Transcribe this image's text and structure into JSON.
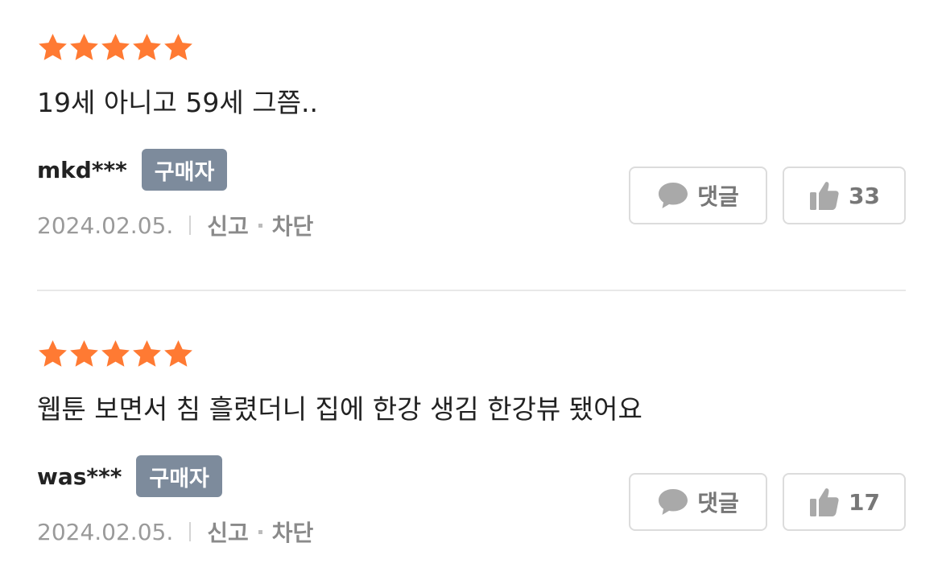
{
  "colors": {
    "star": "#ff7a33",
    "badge_bg": "#7d8b9c",
    "text": "#222222",
    "muted": "#9a9a9a",
    "button_border": "#dcdcdc"
  },
  "reviews": [
    {
      "rating": 5,
      "text": "19세 아니고 59세 그쯤..",
      "author": "mkd***",
      "badge": "구매자",
      "date": "2024.02.05.",
      "report_label": "신고",
      "block_label": "차단",
      "comment_label": "댓글",
      "like_count": "33"
    },
    {
      "rating": 5,
      "text": "웹툰 보면서 침 흘렸더니 집에 한강 생김 한강뷰 됐어요",
      "author": "was***",
      "badge": "구매자",
      "date": "2024.02.05.",
      "report_label": "신고",
      "block_label": "차단",
      "comment_label": "댓글",
      "like_count": "17"
    }
  ]
}
